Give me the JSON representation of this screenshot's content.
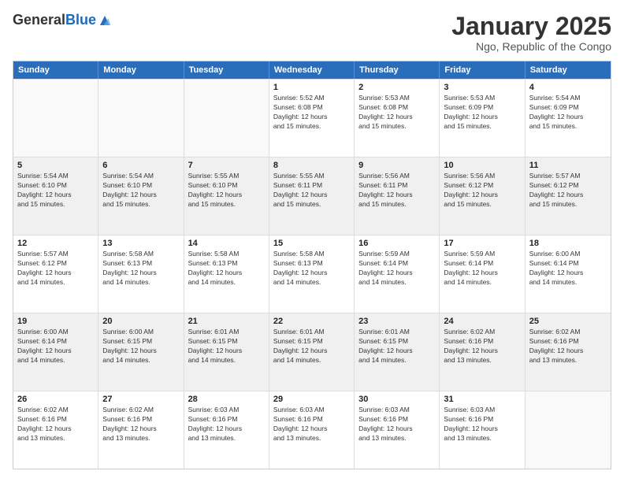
{
  "logo": {
    "general": "General",
    "blue": "Blue"
  },
  "header": {
    "title": "January 2025",
    "subtitle": "Ngo, Republic of the Congo"
  },
  "weekdays": [
    "Sunday",
    "Monday",
    "Tuesday",
    "Wednesday",
    "Thursday",
    "Friday",
    "Saturday"
  ],
  "weeks": [
    [
      {
        "day": "",
        "info": ""
      },
      {
        "day": "",
        "info": ""
      },
      {
        "day": "",
        "info": ""
      },
      {
        "day": "1",
        "info": "Sunrise: 5:52 AM\nSunset: 6:08 PM\nDaylight: 12 hours\nand 15 minutes."
      },
      {
        "day": "2",
        "info": "Sunrise: 5:53 AM\nSunset: 6:08 PM\nDaylight: 12 hours\nand 15 minutes."
      },
      {
        "day": "3",
        "info": "Sunrise: 5:53 AM\nSunset: 6:09 PM\nDaylight: 12 hours\nand 15 minutes."
      },
      {
        "day": "4",
        "info": "Sunrise: 5:54 AM\nSunset: 6:09 PM\nDaylight: 12 hours\nand 15 minutes."
      }
    ],
    [
      {
        "day": "5",
        "info": "Sunrise: 5:54 AM\nSunset: 6:10 PM\nDaylight: 12 hours\nand 15 minutes."
      },
      {
        "day": "6",
        "info": "Sunrise: 5:54 AM\nSunset: 6:10 PM\nDaylight: 12 hours\nand 15 minutes."
      },
      {
        "day": "7",
        "info": "Sunrise: 5:55 AM\nSunset: 6:10 PM\nDaylight: 12 hours\nand 15 minutes."
      },
      {
        "day": "8",
        "info": "Sunrise: 5:55 AM\nSunset: 6:11 PM\nDaylight: 12 hours\nand 15 minutes."
      },
      {
        "day": "9",
        "info": "Sunrise: 5:56 AM\nSunset: 6:11 PM\nDaylight: 12 hours\nand 15 minutes."
      },
      {
        "day": "10",
        "info": "Sunrise: 5:56 AM\nSunset: 6:12 PM\nDaylight: 12 hours\nand 15 minutes."
      },
      {
        "day": "11",
        "info": "Sunrise: 5:57 AM\nSunset: 6:12 PM\nDaylight: 12 hours\nand 15 minutes."
      }
    ],
    [
      {
        "day": "12",
        "info": "Sunrise: 5:57 AM\nSunset: 6:12 PM\nDaylight: 12 hours\nand 14 minutes."
      },
      {
        "day": "13",
        "info": "Sunrise: 5:58 AM\nSunset: 6:13 PM\nDaylight: 12 hours\nand 14 minutes."
      },
      {
        "day": "14",
        "info": "Sunrise: 5:58 AM\nSunset: 6:13 PM\nDaylight: 12 hours\nand 14 minutes."
      },
      {
        "day": "15",
        "info": "Sunrise: 5:58 AM\nSunset: 6:13 PM\nDaylight: 12 hours\nand 14 minutes."
      },
      {
        "day": "16",
        "info": "Sunrise: 5:59 AM\nSunset: 6:14 PM\nDaylight: 12 hours\nand 14 minutes."
      },
      {
        "day": "17",
        "info": "Sunrise: 5:59 AM\nSunset: 6:14 PM\nDaylight: 12 hours\nand 14 minutes."
      },
      {
        "day": "18",
        "info": "Sunrise: 6:00 AM\nSunset: 6:14 PM\nDaylight: 12 hours\nand 14 minutes."
      }
    ],
    [
      {
        "day": "19",
        "info": "Sunrise: 6:00 AM\nSunset: 6:14 PM\nDaylight: 12 hours\nand 14 minutes."
      },
      {
        "day": "20",
        "info": "Sunrise: 6:00 AM\nSunset: 6:15 PM\nDaylight: 12 hours\nand 14 minutes."
      },
      {
        "day": "21",
        "info": "Sunrise: 6:01 AM\nSunset: 6:15 PM\nDaylight: 12 hours\nand 14 minutes."
      },
      {
        "day": "22",
        "info": "Sunrise: 6:01 AM\nSunset: 6:15 PM\nDaylight: 12 hours\nand 14 minutes."
      },
      {
        "day": "23",
        "info": "Sunrise: 6:01 AM\nSunset: 6:15 PM\nDaylight: 12 hours\nand 14 minutes."
      },
      {
        "day": "24",
        "info": "Sunrise: 6:02 AM\nSunset: 6:16 PM\nDaylight: 12 hours\nand 13 minutes."
      },
      {
        "day": "25",
        "info": "Sunrise: 6:02 AM\nSunset: 6:16 PM\nDaylight: 12 hours\nand 13 minutes."
      }
    ],
    [
      {
        "day": "26",
        "info": "Sunrise: 6:02 AM\nSunset: 6:16 PM\nDaylight: 12 hours\nand 13 minutes."
      },
      {
        "day": "27",
        "info": "Sunrise: 6:02 AM\nSunset: 6:16 PM\nDaylight: 12 hours\nand 13 minutes."
      },
      {
        "day": "28",
        "info": "Sunrise: 6:03 AM\nSunset: 6:16 PM\nDaylight: 12 hours\nand 13 minutes."
      },
      {
        "day": "29",
        "info": "Sunrise: 6:03 AM\nSunset: 6:16 PM\nDaylight: 12 hours\nand 13 minutes."
      },
      {
        "day": "30",
        "info": "Sunrise: 6:03 AM\nSunset: 6:16 PM\nDaylight: 12 hours\nand 13 minutes."
      },
      {
        "day": "31",
        "info": "Sunrise: 6:03 AM\nSunset: 6:16 PM\nDaylight: 12 hours\nand 13 minutes."
      },
      {
        "day": "",
        "info": ""
      }
    ]
  ]
}
